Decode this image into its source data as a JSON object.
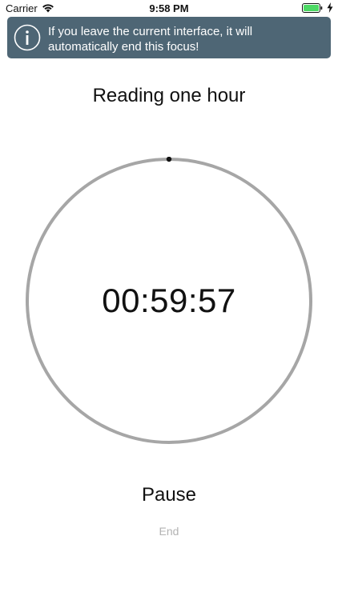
{
  "status_bar": {
    "carrier": "Carrier",
    "time": "9:58 PM",
    "icons": [
      "wifi-icon",
      "battery-icon",
      "charging-icon"
    ]
  },
  "banner": {
    "message": "If you leave the current interface, it will automatically end this focus!",
    "icon": "info-icon",
    "background_color": "#4e6675"
  },
  "focus": {
    "title": "Reading one hour",
    "time_remaining": "00:59:57",
    "ring_color": "#a6a6a6",
    "progress_dot_color": "#111111"
  },
  "actions": {
    "pause_label": "Pause",
    "end_label": "End"
  }
}
